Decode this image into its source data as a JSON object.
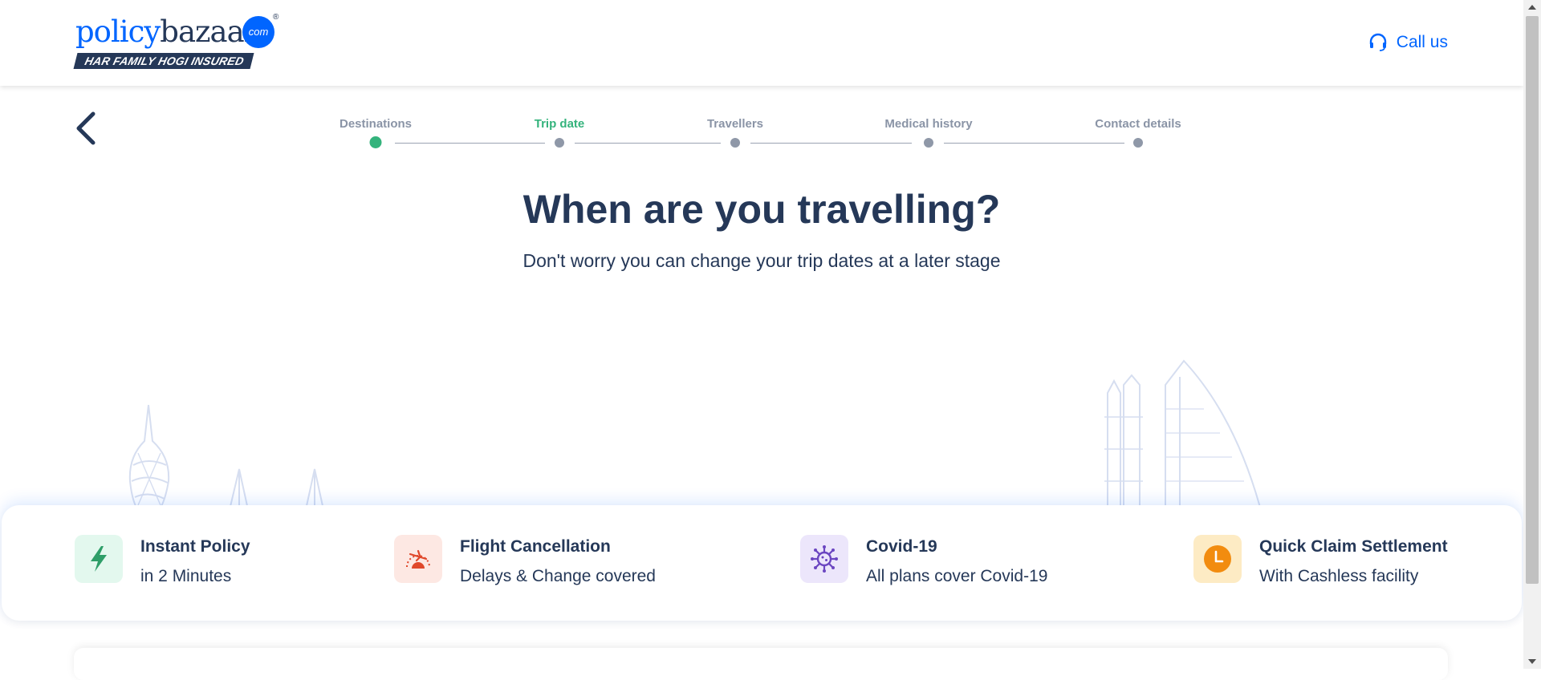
{
  "header": {
    "logo_word_1": "policy",
    "logo_word_2": "bazaar",
    "logo_badge": "com",
    "logo_reg": "®",
    "logo_tagline": "HAR FAMILY HOGI INSURED",
    "call_label": "Call us",
    "call_icon": "headset-icon"
  },
  "colors": {
    "brand_blue": "#0065ff",
    "navy": "#253858",
    "step_active": "#34b37c",
    "step_inactive": "#8f98a8"
  },
  "stepper": {
    "current_index": 1,
    "steps": [
      {
        "label": "Destinations"
      },
      {
        "label": "Trip date"
      },
      {
        "label": "Travellers"
      },
      {
        "label": "Medical history"
      },
      {
        "label": "Contact details"
      }
    ]
  },
  "main": {
    "title": "When are you travelling?",
    "subtitle": "Don't worry you can change your trip dates at a later stage"
  },
  "features": [
    {
      "title": "Instant Policy",
      "subtitle": "in 2 Minutes",
      "icon": "lightning-icon"
    },
    {
      "title": "Flight Cancellation",
      "subtitle": "Delays & Change covered",
      "icon": "flight-cancel-icon"
    },
    {
      "title": "Covid-19",
      "subtitle": "All plans cover Covid-19",
      "icon": "virus-icon"
    },
    {
      "title": "Quick Claim Settlement",
      "subtitle": "With Cashless facility",
      "icon": "clock-icon"
    }
  ]
}
